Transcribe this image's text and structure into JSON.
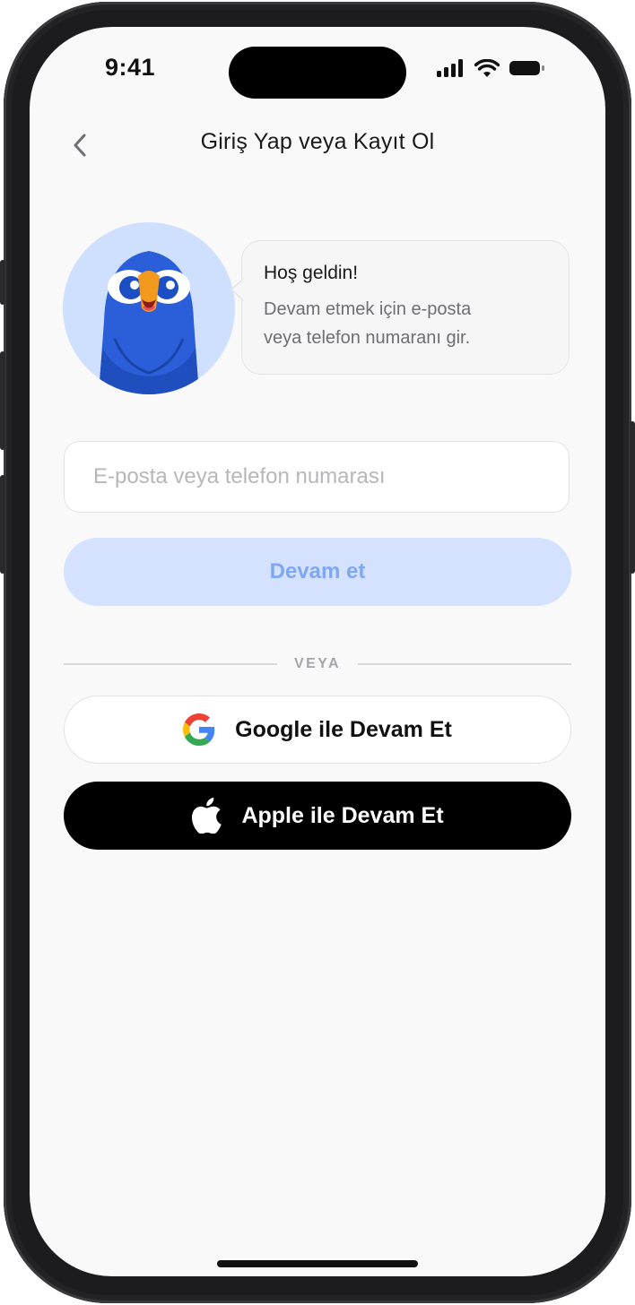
{
  "status_bar": {
    "time": "9:41"
  },
  "header": {
    "title": "Giriş Yap veya Kayıt Ol"
  },
  "welcome": {
    "title": "Hoş geldin!",
    "line1": "Devam etmek için e-posta",
    "line2": "veya telefon numaranı gir."
  },
  "form": {
    "input_placeholder": "E-posta veya telefon numarası",
    "input_value": "",
    "continue_label": "Devam et"
  },
  "divider": {
    "label": "VEYA"
  },
  "social": {
    "google_label": "Google ile Devam Et",
    "apple_label": "Apple ile Devam Et"
  },
  "colors": {
    "primary_light": "#d4e2ff",
    "primary_text": "#7ea7f4",
    "mascot_blue": "#2b5fd9",
    "mascot_beak": "#f39a1e",
    "background": "#f9f9f9"
  },
  "icons": {
    "back": "chevron-left-icon",
    "google": "google-logo-icon",
    "apple": "apple-logo-icon",
    "signal": "cellular-signal-icon",
    "wifi": "wifi-icon",
    "battery": "battery-icon"
  }
}
